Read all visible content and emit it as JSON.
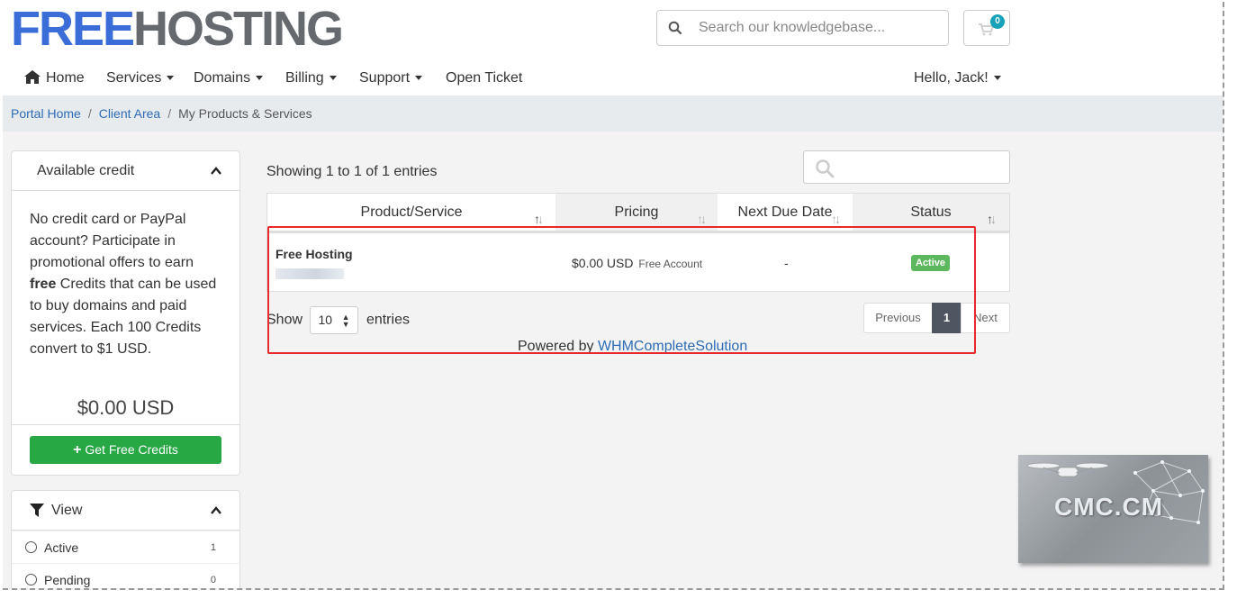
{
  "logo": {
    "part1": "FREE",
    "part2": "HOSTING"
  },
  "header": {
    "search_placeholder": "Search our knowledgebase...",
    "cart_count": "0"
  },
  "nav": {
    "home": "Home",
    "services": "Services",
    "domains": "Domains",
    "billing": "Billing",
    "support": "Support",
    "open_ticket": "Open Ticket",
    "user": "Hello, Jack!"
  },
  "breadcrumb": {
    "portal_home": "Portal Home",
    "client_area": "Client Area",
    "current": "My Products & Services"
  },
  "sidebar": {
    "credit": {
      "title": "Available credit",
      "text_before": "No credit card or PayPal account? Participate in promotional offers to earn ",
      "text_bold": "free",
      "text_after": " Credits that can be used to buy domains and paid services. Each 100 Credits convert to $1 USD.",
      "amount": "$0.00 USD",
      "button": "Get Free Credits"
    },
    "view": {
      "title": "View",
      "items": [
        {
          "label": "Active",
          "count": "1"
        },
        {
          "label": "Pending",
          "count": "0"
        }
      ]
    }
  },
  "main": {
    "showing": "Showing 1 to 1 of 1 entries",
    "columns": [
      "Product/Service",
      "Pricing",
      "Next Due Date",
      "Status"
    ],
    "rows": [
      {
        "product": "Free Hosting",
        "domain": "",
        "price": "$0.00 USD",
        "cycle": "Free Account",
        "next_due": "-",
        "status": "Active"
      }
    ],
    "show_label": "Show",
    "page_size": "10",
    "entries_label": "entries",
    "pager": {
      "previous": "Previous",
      "page": "1",
      "next": "Next"
    },
    "powered_prefix": "Powered by ",
    "powered_link": "WHMCompleteSolution"
  },
  "watermark": "CMC.CM",
  "colors": {
    "brand_blue": "#3a6dd8",
    "brand_gray": "#666a6e",
    "link": "#2d6cb5",
    "success": "#28a745",
    "status_active": "#5cb85c",
    "highlight_box": "#e8292b"
  }
}
